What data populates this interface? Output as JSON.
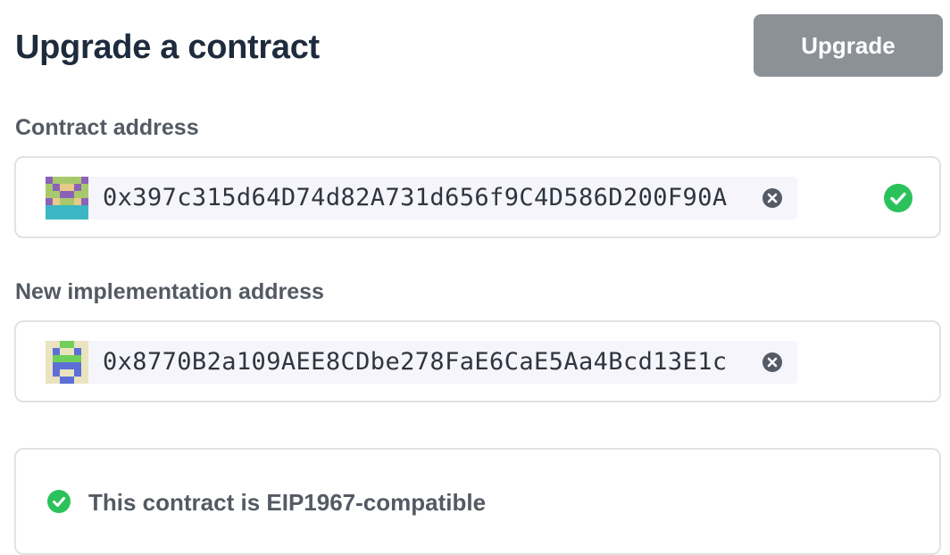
{
  "header": {
    "title": "Upgrade a contract",
    "upgrade_label": "Upgrade"
  },
  "contract_field": {
    "label": "Contract address",
    "value": "0x397c315d64D74d82A731d656f9C4D586D200F90A",
    "identicon": "contract-identicon",
    "clear_icon": "clear-icon",
    "status_icon": "check-circle-icon"
  },
  "implementation_field": {
    "label": "New implementation address",
    "value": "0x8770B2a109AEE8CDbe278FaE6CaE5Aa4Bcd13E1c",
    "identicon": "implementation-identicon",
    "clear_icon": "clear-icon"
  },
  "compatibility": {
    "message": "This contract is EIP1967-compatible",
    "icon": "check-circle-icon"
  },
  "colors": {
    "title": "#1e2b3d",
    "label": "#535a63",
    "button_bg": "#8c9198",
    "success": "#2cc25b",
    "clear_icon": "#555b66",
    "chip_bg": "#f5f5fb",
    "border": "#e0e2e6"
  }
}
